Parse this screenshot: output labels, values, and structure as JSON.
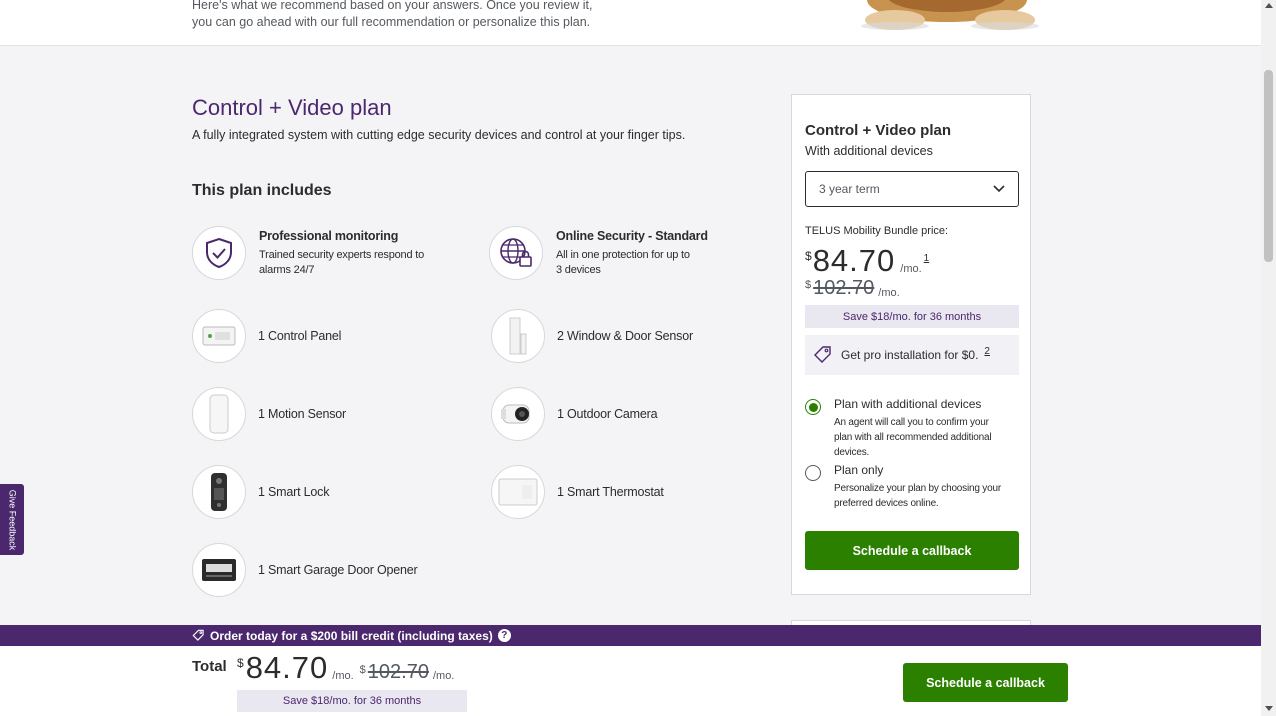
{
  "intro": {
    "text": "Here's what we recommend based on your answers. Once you review it, you can go ahead with our full recommendation or personalize this plan."
  },
  "plan": {
    "title": "Control + Video plan",
    "description": "A fully integrated system with cutting edge security devices and control at your finger tips.",
    "includes_title": "This plan includes"
  },
  "features": [
    {
      "name": "Professional monitoring",
      "description": "Trained security experts respond to alarms 24/7",
      "icon": "shield-check-icon"
    },
    {
      "name": "Online Security - Standard",
      "description": "All in one protection for up to 3 devices",
      "icon": "globe-lock-icon"
    }
  ],
  "devices": [
    {
      "label": "1 Control Panel",
      "icon": "control-panel-icon"
    },
    {
      "label": "2 Window & Door Sensor",
      "icon": "door-sensor-icon"
    },
    {
      "label": "1 Motion Sensor",
      "icon": "motion-sensor-icon"
    },
    {
      "label": "1 Outdoor Camera",
      "icon": "outdoor-camera-icon"
    },
    {
      "label": "1 Smart Lock",
      "icon": "smart-lock-icon"
    },
    {
      "label": "1 Smart Thermostat",
      "icon": "thermostat-icon"
    },
    {
      "label": "1 Smart Garage Door Opener",
      "icon": "garage-opener-icon"
    }
  ],
  "summary": {
    "title": "Control + Video plan",
    "subtitle": "With additional devices",
    "term_selected": "3 year term",
    "bundle_label": "TELUS Mobility Bundle price:",
    "currency": "$",
    "price": "84.70",
    "per_month": "/mo.",
    "footnote_1": "1",
    "old_price": "102.70",
    "old_per_month": "/mo.",
    "save_text": "Save $18/mo. for 36 months",
    "promo_text": "Get pro installation for $0.",
    "footnote_2": "2",
    "options": [
      {
        "label": "Plan with additional devices",
        "description": "An agent will call you to confirm your plan with all recommended additional devices.",
        "checked": true
      },
      {
        "label": "Plan only",
        "description": "Personalize your plan by choosing your preferred devices online.",
        "checked": false
      }
    ],
    "cta": "Schedule a callback"
  },
  "feedback": {
    "label": "Give Feedback"
  },
  "promo_bar": {
    "text": "Order today for a $200 bill credit (including taxes)",
    "help": "?"
  },
  "bottom": {
    "total_label": "Total",
    "currency": "$",
    "price": "84.70",
    "per_month": "/mo.",
    "old_currency": "$",
    "old_price": "102.70",
    "old_per_month": "/mo.",
    "save_text": "Save $18/mo. for 36 months",
    "cta": "Schedule a callback"
  },
  "colors": {
    "brand_purple": "#4b286d",
    "cta_green": "#2b8000",
    "save_pill": "#e9e7f0"
  }
}
